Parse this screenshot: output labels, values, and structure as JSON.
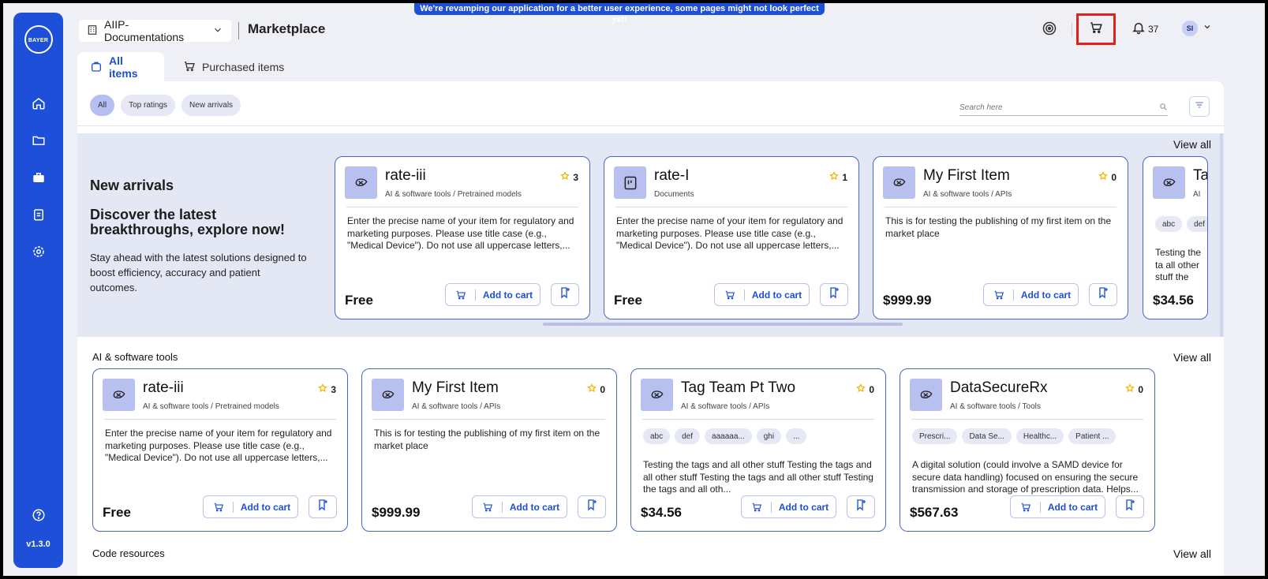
{
  "banner": "We're revamping our application for a better user experience, some pages might not look perfect yet!",
  "sidebar": {
    "logo_h": "BAYER",
    "logo_v": "BAYER",
    "version": "v1.3.0",
    "items": [
      "home-icon",
      "folder-icon",
      "briefcase-icon",
      "clipboard-icon",
      "gear-icon"
    ]
  },
  "header": {
    "workspace": "AIIP-Documentations",
    "title": "Marketplace",
    "notifications": "37",
    "avatar": "SI"
  },
  "tabs": {
    "all": "All items",
    "purchased": "Purchased items"
  },
  "filters": {
    "chips": [
      "All",
      "Top ratings",
      "New arrivals"
    ],
    "search_placeholder": "Search here"
  },
  "new_arrivals": {
    "title": "New arrivals",
    "heading": "Discover the latest breakthroughs, explore now!",
    "description": "Stay ahead with the latest solutions designed to boost efficiency, accuracy and patient outcomes.",
    "view_all": "View all",
    "cards": [
      {
        "name": "rate-iii",
        "category": "AI & software tools / Pretrained models",
        "rating": "3",
        "description": "Enter the precise name of your item for regulatory and marketing purposes. Please use title case (e.g., \"Medical Device\"). Do not use all uppercase letters,...",
        "price": "Free",
        "icon": "brain-icon"
      },
      {
        "name": "rate-I",
        "category": "Documents",
        "rating": "1",
        "description": "Enter the precise name of your item for regulatory and marketing purposes. Please use title case (e.g., \"Medical Device\"). Do not use all uppercase letters,...",
        "price": "Free",
        "icon": "document-icon"
      },
      {
        "name": "My First Item",
        "category": "AI & software tools / APIs",
        "rating": "0",
        "description": "This is for testing the publishing of my first item on the market place",
        "price": "$999.99",
        "icon": "brain-icon"
      },
      {
        "name": "Ta",
        "category": "AI",
        "rating": "",
        "tags": [
          "abc",
          "def"
        ],
        "description": "Testing the ta all other stuff the tags and",
        "price": "$34.56",
        "icon": "brain-icon"
      }
    ]
  },
  "ai_tools": {
    "title": "AI & software tools",
    "view_all": "View all",
    "cards": [
      {
        "name": "rate-iii",
        "category": "AI & software tools / Pretrained models",
        "rating": "3",
        "description": "Enter the precise name of your item for regulatory and marketing purposes. Please use title case (e.g., \"Medical Device\"). Do not use all uppercase letters,...",
        "price": "Free",
        "icon": "brain-icon"
      },
      {
        "name": "My First Item",
        "category": "AI & software tools / APIs",
        "rating": "0",
        "description": "This is for testing the publishing of my first item on the market place",
        "price": "$999.99",
        "icon": "brain-icon"
      },
      {
        "name": "Tag Team Pt Two",
        "category": "AI & software tools / APIs",
        "rating": "0",
        "tags": [
          "abc",
          "def",
          "aaaaaa...",
          "ghi",
          "..."
        ],
        "description": "Testing the tags and all other stuff Testing the tags and all other stuff Testing the tags and all other stuff Testing the tags and all oth...",
        "price": "$34.56",
        "icon": "brain-icon"
      },
      {
        "name": "DataSecureRx",
        "category": "AI & software tools / Tools",
        "rating": "0",
        "tags": [
          "Prescri...",
          "Data Se...",
          "Healthc...",
          "Patient ..."
        ],
        "description": "A digital solution (could involve a SAMD device for secure data handling) focused on ensuring the secure transmission and storage of prescription data. Helps...",
        "price": "$567.63",
        "icon": "brain-icon"
      }
    ]
  },
  "code_resources": {
    "title": "Code resources",
    "view_all": "View all"
  },
  "labels": {
    "add_to_cart": "Add to cart"
  },
  "colors": {
    "primary": "#1d4fd8",
    "highlight": "#e0201b",
    "star": "#f2b705"
  }
}
